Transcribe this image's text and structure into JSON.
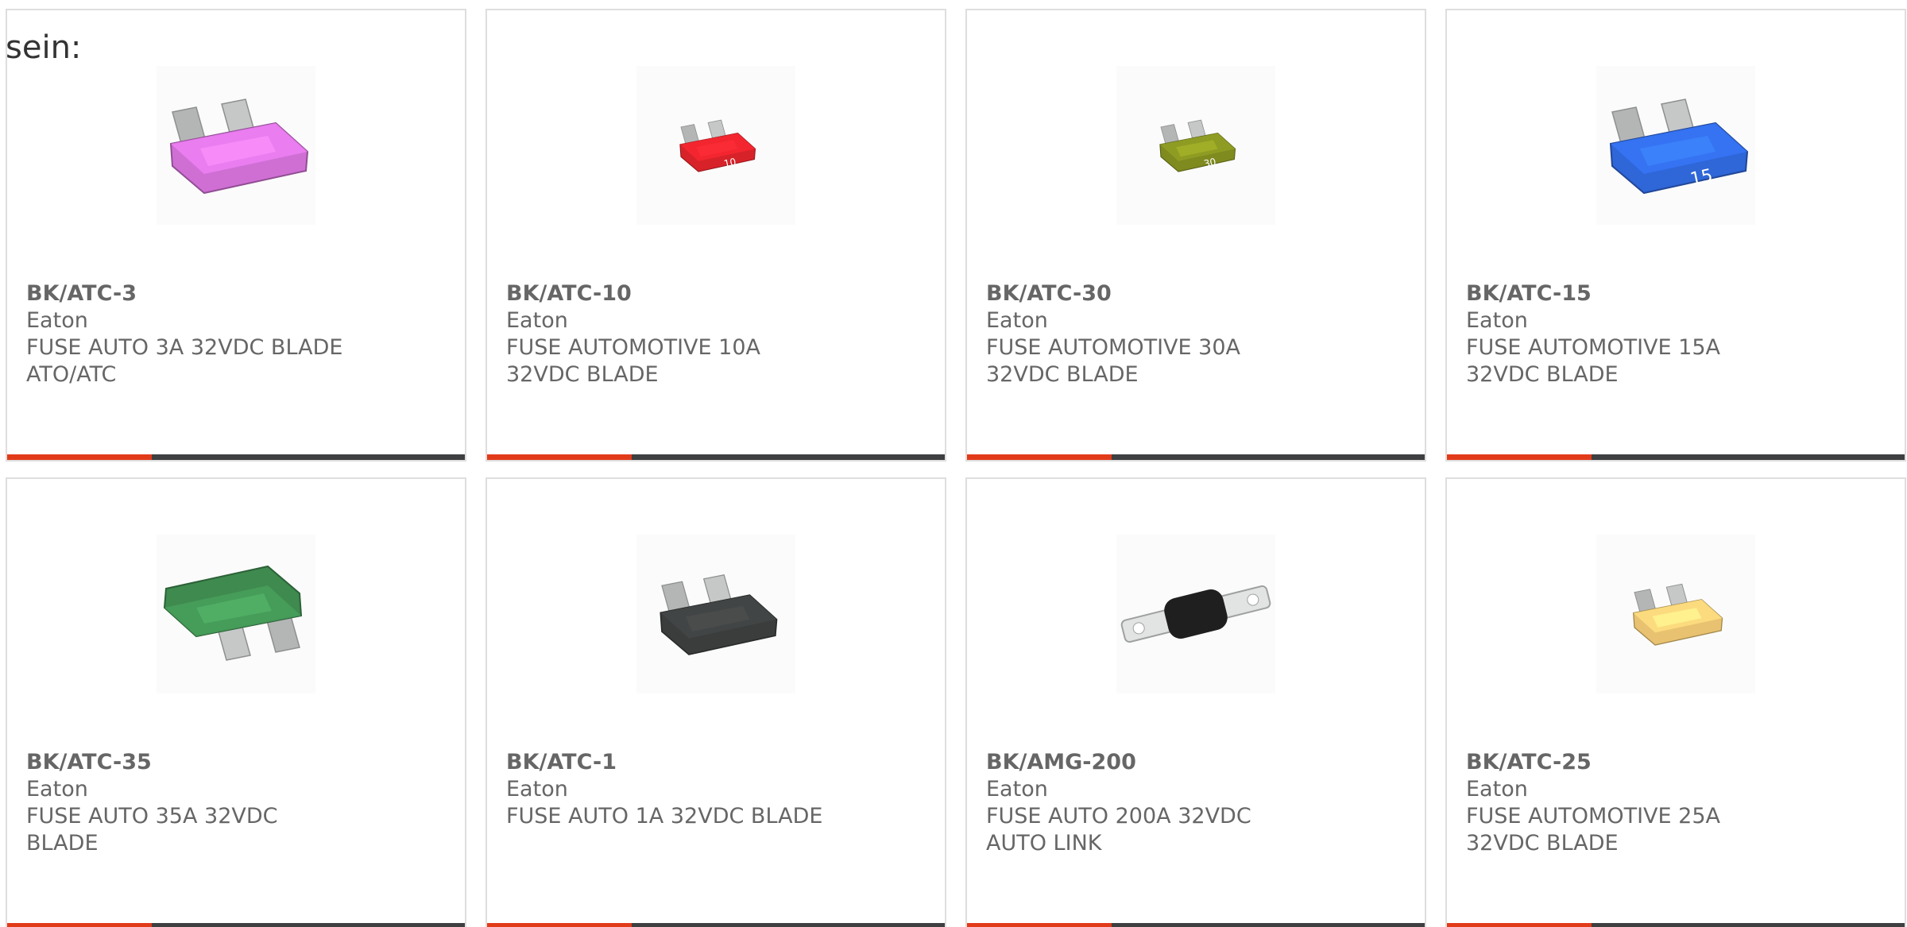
{
  "intro_text": "sein:",
  "accent_color": "#e23b1a",
  "products": [
    {
      "pn": "BK/ATC-3",
      "mfr": "Eaton",
      "desc": "FUSE AUTO 3A 32VDC BLADE ATO/ATC",
      "icon": "blade-fuse-icon",
      "body_color": "#cf6fd4",
      "label": ""
    },
    {
      "pn": "BK/ATC-10",
      "mfr": "Eaton",
      "desc": "FUSE AUTOMOTIVE 10A 32VDC BLADE",
      "icon": "blade-fuse-icon",
      "body_color": "#d8222a",
      "label": "10"
    },
    {
      "pn": "BK/ATC-30",
      "mfr": "Eaton",
      "desc": "FUSE AUTOMOTIVE 30A 32VDC BLADE",
      "icon": "blade-fuse-icon",
      "body_color": "#7f8a1f",
      "label": "30"
    },
    {
      "pn": "BK/ATC-15",
      "mfr": "Eaton",
      "desc": "FUSE AUTOMOTIVE 15A 32VDC BLADE",
      "icon": "blade-fuse-icon",
      "body_color": "#2f66d8",
      "label": "15"
    },
    {
      "pn": "BK/ATC-35",
      "mfr": "Eaton",
      "desc": "FUSE AUTO 35A 32VDC BLADE",
      "icon": "blade-fuse-icon",
      "body_color": "#3f8a4f",
      "label": ""
    },
    {
      "pn": "BK/ATC-1",
      "mfr": "Eaton",
      "desc": "FUSE AUTO 1A 32VDC BLADE",
      "icon": "blade-fuse-icon",
      "body_color": "#3b3d3d",
      "label": ""
    },
    {
      "pn": "BK/AMG-200",
      "mfr": "Eaton",
      "desc": "FUSE AUTO 200A 32VDC AUTO LINK",
      "icon": "link-fuse-icon",
      "body_color": "#1f1f1f",
      "label": ""
    },
    {
      "pn": "BK/ATC-25",
      "mfr": "Eaton",
      "desc": "FUSE AUTOMOTIVE 25A 32VDC BLADE",
      "icon": "blade-fuse-icon",
      "body_color": "#e8c270",
      "label": ""
    }
  ]
}
